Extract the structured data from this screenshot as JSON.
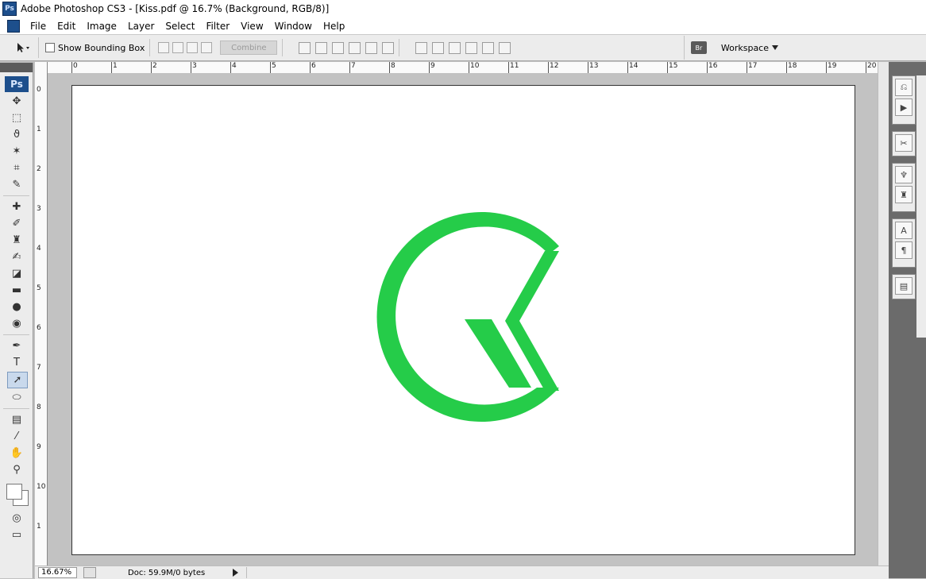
{
  "window": {
    "title": "Adobe Photoshop CS3 - [Kiss.pdf @ 16.7% (Background, RGB/8)]"
  },
  "menu": [
    "File",
    "Edit",
    "Image",
    "Layer",
    "Select",
    "Filter",
    "View",
    "Window",
    "Help"
  ],
  "options": {
    "show_bounding_box": "Show Bounding Box",
    "combine": "Combine",
    "workspace": "Workspace"
  },
  "toolbox_badge": "Ps",
  "ruler": {
    "h": [
      "0",
      "1",
      "2",
      "3",
      "4",
      "5",
      "6",
      "7",
      "8",
      "9",
      "10",
      "11",
      "12",
      "13",
      "14",
      "15",
      "16",
      "17",
      "18",
      "19",
      "20"
    ],
    "v": [
      "0",
      "1",
      "2",
      "3",
      "4",
      "5",
      "6",
      "7",
      "8",
      "9",
      "10",
      "1"
    ]
  },
  "status": {
    "zoom": "16.67%",
    "doc": "Doc: 59.9M/0 bytes"
  },
  "canvas": {
    "logo_color": "#25cc49"
  }
}
